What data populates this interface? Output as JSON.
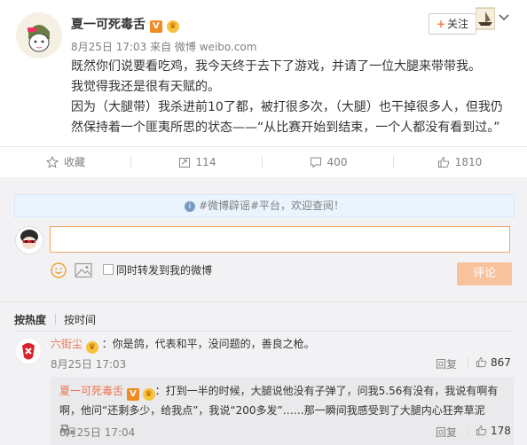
{
  "post": {
    "author": "夏一可死毒舌",
    "time": "8月25日 17:03 来自 微博 weibo.com",
    "follow_label": "关注",
    "body": [
      "既然你们说要看吃鸡，我今天终于去下了游戏，并请了一位大腿来带带我。",
      "我觉得我还是很有天赋的。",
      "因为（大腿带）我杀进前10了都，被打很多次，（大腿）也干掉很多人，但我仍然保持着一个匪夷所思的状态——“从比赛开始到结束，一个人都没有看到过。”"
    ]
  },
  "actions": {
    "favorite": "收藏",
    "repost": "114",
    "comment": "400",
    "like": "1810"
  },
  "comment_box": {
    "notice": "#微博辟谣#平台，欢迎查阅！",
    "repost_label": "同时转发到我的微博",
    "submit_label": "评论"
  },
  "sort": {
    "hot": "按热度",
    "time": "按时间"
  },
  "comments": [
    {
      "name": "六街尘",
      "text": "：你是鸽，代表和平，没问题的，善良之枪。",
      "time": "8月25日 17:03",
      "reply_label": "回复",
      "likes": "867",
      "reply": {
        "name": "夏一可死毒舌",
        "text": "：打到一半的时候，大腿说他没有子弹了，问我5.56有没有，我说有啊有啊，他问“还剩多少，给我点”，我说“200多发”……那一瞬间我感受到了大腿内心狂奔草泥马。",
        "time": "8月25日 17:04",
        "reply_label": "回复",
        "likes": "178"
      }
    }
  ],
  "colors": {
    "accent": "#eb7350",
    "link": "#eb7350",
    "button_disabled": "#f7c29c"
  }
}
